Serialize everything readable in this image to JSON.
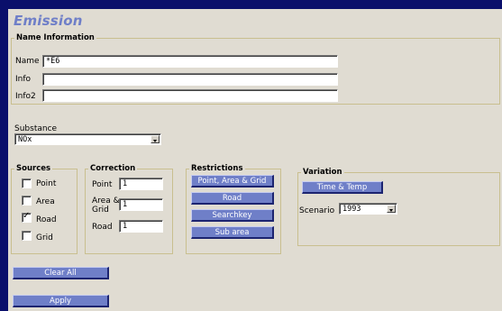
{
  "title": "Emission",
  "name_info": {
    "legend": "Name Information",
    "name_label": "Name",
    "name_value": "*E6",
    "info_label": "Info",
    "info_value": "",
    "info2_label": "Info2",
    "info2_value": ""
  },
  "substance": {
    "label": "Substance",
    "selected": "NOx"
  },
  "sources": {
    "legend": "Sources",
    "items": [
      {
        "label": "Point",
        "checked": false
      },
      {
        "label": "Area",
        "checked": false
      },
      {
        "label": "Road",
        "checked": true
      },
      {
        "label": "Grid",
        "checked": false
      }
    ]
  },
  "correction": {
    "legend": "Correction",
    "point_label": "Point",
    "point_value": "1",
    "area_grid_label_line1": "Area &",
    "area_grid_label_line2": "Grid",
    "area_grid_value": "1",
    "road_label": "Road",
    "road_value": "1"
  },
  "restrictions": {
    "legend": "Restrictions",
    "buttons": [
      "Point, Area & Grid",
      "Road",
      "Searchkey",
      "Sub area"
    ]
  },
  "variation": {
    "legend": "Variation",
    "time_temp_button": "Time & Temp",
    "scenario_label": "Scenario",
    "scenario_selected": "1993"
  },
  "actions": {
    "clear_all": "Clear All",
    "apply": "Apply"
  },
  "colors": {
    "accent": "#6f7fc8",
    "panel_bg": "#e0dcd2",
    "frame": "#0a0f6b"
  }
}
